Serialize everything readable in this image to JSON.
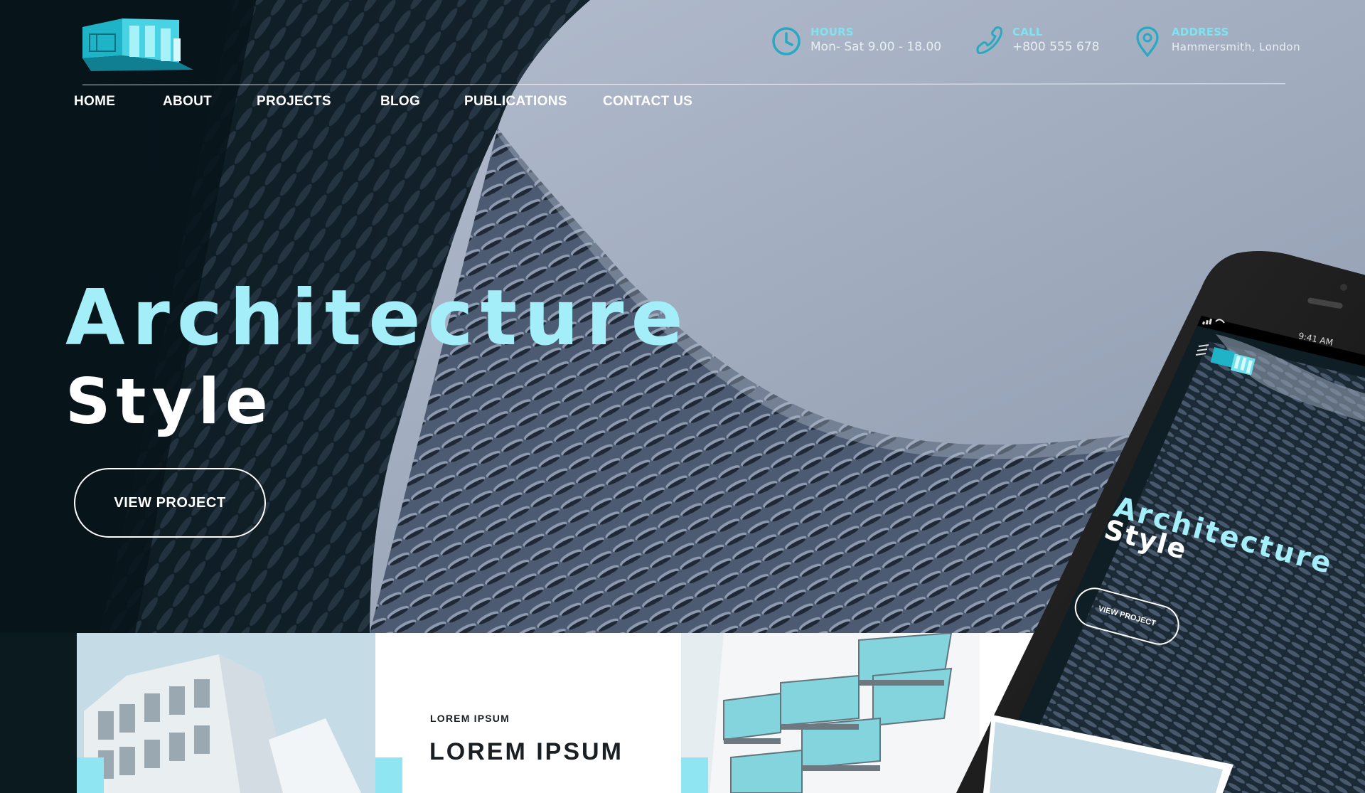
{
  "header": {
    "logo": "building-logo",
    "hours": {
      "label": "HOURS",
      "value": "Mon- Sat 9.00 - 18.00",
      "icon": "clock-icon"
    },
    "call": {
      "label": "CALL",
      "value": "+800 555 678",
      "icon": "phone-icon"
    },
    "address": {
      "label": "ADDRESS",
      "value": "Hammersmith, London",
      "icon": "map-pin-icon"
    }
  },
  "nav": {
    "items": [
      {
        "label": "HOME"
      },
      {
        "label": "ABOUT"
      },
      {
        "label": "PROJECTS"
      },
      {
        "label": "BLOG"
      },
      {
        "label": "PUBLICATIONS"
      },
      {
        "label": "CONTACT US"
      }
    ]
  },
  "hero": {
    "title_line1": "Architecture",
    "title_line2": "Style",
    "cta_label": "VIEW PROJECT"
  },
  "cards": {
    "eyebrow": "LOREM IPSUM",
    "heading": "LOREM IPSUM"
  },
  "phone": {
    "time": "9:41 AM",
    "title_line1": "Architecture",
    "title_line2": "Style",
    "cta_label": "VIEW PROJECT",
    "icons": [
      "hamburger-menu-icon",
      "signal-icon",
      "wifi-icon"
    ]
  },
  "colors": {
    "accent": "#7fe3f0",
    "title_cyan": "#a3eef8",
    "dark": "#0b1a1f",
    "sky": "#9aa6b8"
  }
}
